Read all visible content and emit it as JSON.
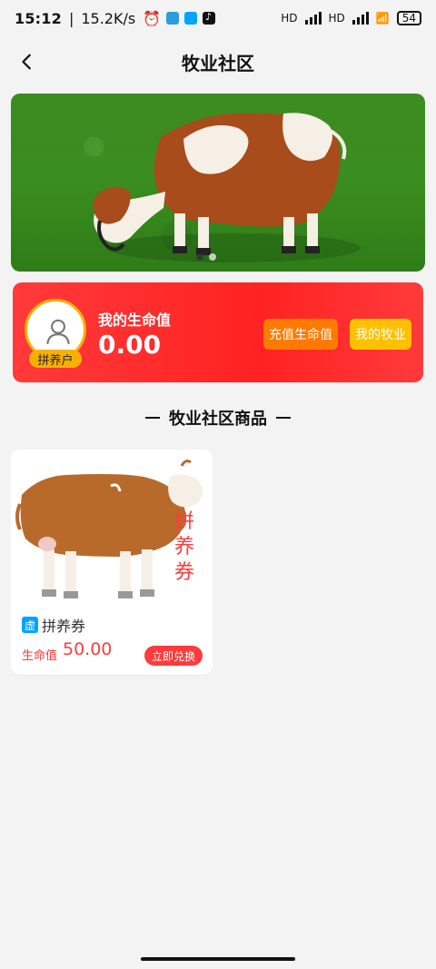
{
  "status_bar": {
    "time": "15:12",
    "speed": "15.2K/s",
    "battery": "54",
    "hd_labels": [
      "HD",
      "HD"
    ]
  },
  "nav": {
    "title": "牧业社区",
    "back_icon": "chevron-left-icon"
  },
  "banner": {
    "image_desc": "cow-on-grass-banner",
    "dots": 2,
    "active_index": 0
  },
  "life_card": {
    "avatar_badge": "拼养户",
    "label": "我的生命值",
    "value": "0.00",
    "buttons": {
      "recharge": "充值生命值",
      "mine": "我的牧业"
    }
  },
  "section": {
    "title": "牧业社区商品"
  },
  "products": [
    {
      "name": "拼养券",
      "badge": "虚",
      "price_label": "生命值",
      "price_value": "50.00",
      "action": "立即兑换",
      "image_text": [
        "拼",
        "养",
        "券"
      ]
    }
  ],
  "colors": {
    "primary_red": "#ff2222",
    "accent_orange": "#ff7a00",
    "accent_yellow": "#ffc000",
    "badge_blue": "#00a3ff"
  }
}
